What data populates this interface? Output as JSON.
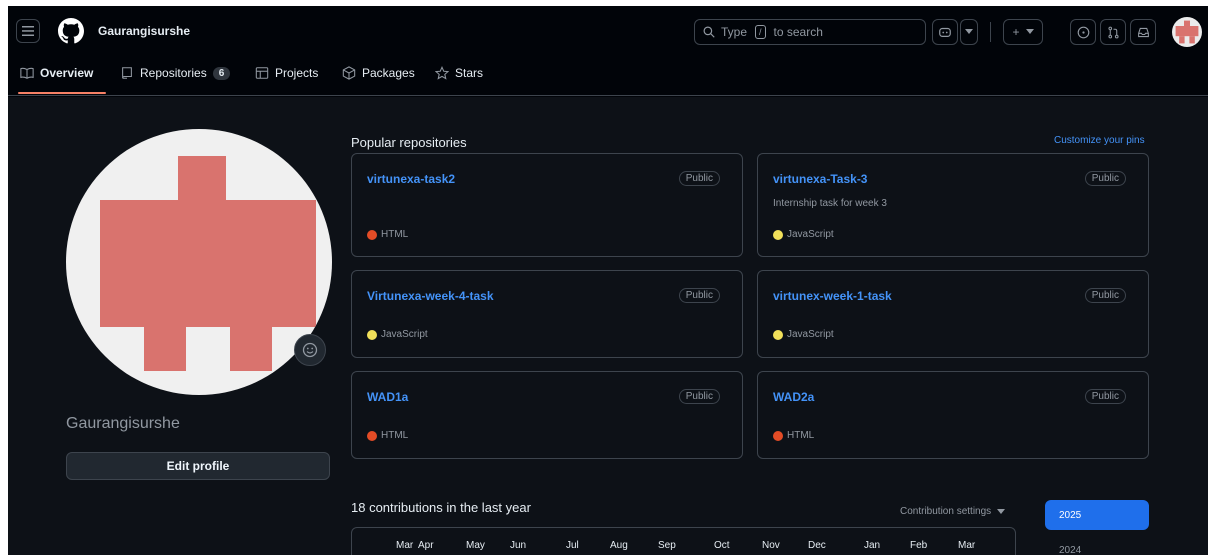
{
  "header": {
    "username": "Gaurangisurshe",
    "search_placeholder_pre": "Type",
    "search_slash": "/",
    "search_placeholder_post": "to search",
    "plus": "+"
  },
  "tabs": [
    {
      "label": "Overview",
      "icon": "book-icon"
    },
    {
      "label": "Repositories",
      "icon": "repo-icon",
      "count": "6"
    },
    {
      "label": "Projects",
      "icon": "table-icon"
    },
    {
      "label": "Packages",
      "icon": "package-icon"
    },
    {
      "label": "Stars",
      "icon": "star-icon"
    }
  ],
  "profile": {
    "name": "Gaurangisurshe",
    "edit_label": "Edit profile"
  },
  "popular": {
    "title": "Popular repositories",
    "customize": "Customize your pins",
    "repos": [
      {
        "name": "virtunexa-task2",
        "visibility": "Public",
        "description": "",
        "language": "HTML",
        "lang_color": "#e34c26"
      },
      {
        "name": "virtunexa-Task-3",
        "visibility": "Public",
        "description": "Internship task for week 3",
        "language": "JavaScript",
        "lang_color": "#f1e05a"
      },
      {
        "name": "Virtunexa-week-4-task",
        "visibility": "Public",
        "description": "",
        "language": "JavaScript",
        "lang_color": "#f1e05a"
      },
      {
        "name": "virtunex-week-1-task",
        "visibility": "Public",
        "description": "",
        "language": "JavaScript",
        "lang_color": "#f1e05a"
      },
      {
        "name": "WAD1a",
        "visibility": "Public",
        "description": "",
        "language": "HTML",
        "lang_color": "#e34c26"
      },
      {
        "name": "WAD2a",
        "visibility": "Public",
        "description": "",
        "language": "HTML",
        "lang_color": "#e34c26"
      }
    ]
  },
  "contributions": {
    "title": "18 contributions in the last year",
    "settings": "Contribution settings",
    "months": [
      "Mar",
      "Apr",
      "May",
      "Jun",
      "Jul",
      "Aug",
      "Sep",
      "Oct",
      "Nov",
      "Dec",
      "Jan",
      "Feb",
      "Mar"
    ],
    "years": [
      "2025",
      "2024"
    ]
  },
  "colors": {
    "accent_link": "#4493f8",
    "tab_underline": "#f78166",
    "year_active": "#1f6feb",
    "avatar": "#d9736e"
  }
}
